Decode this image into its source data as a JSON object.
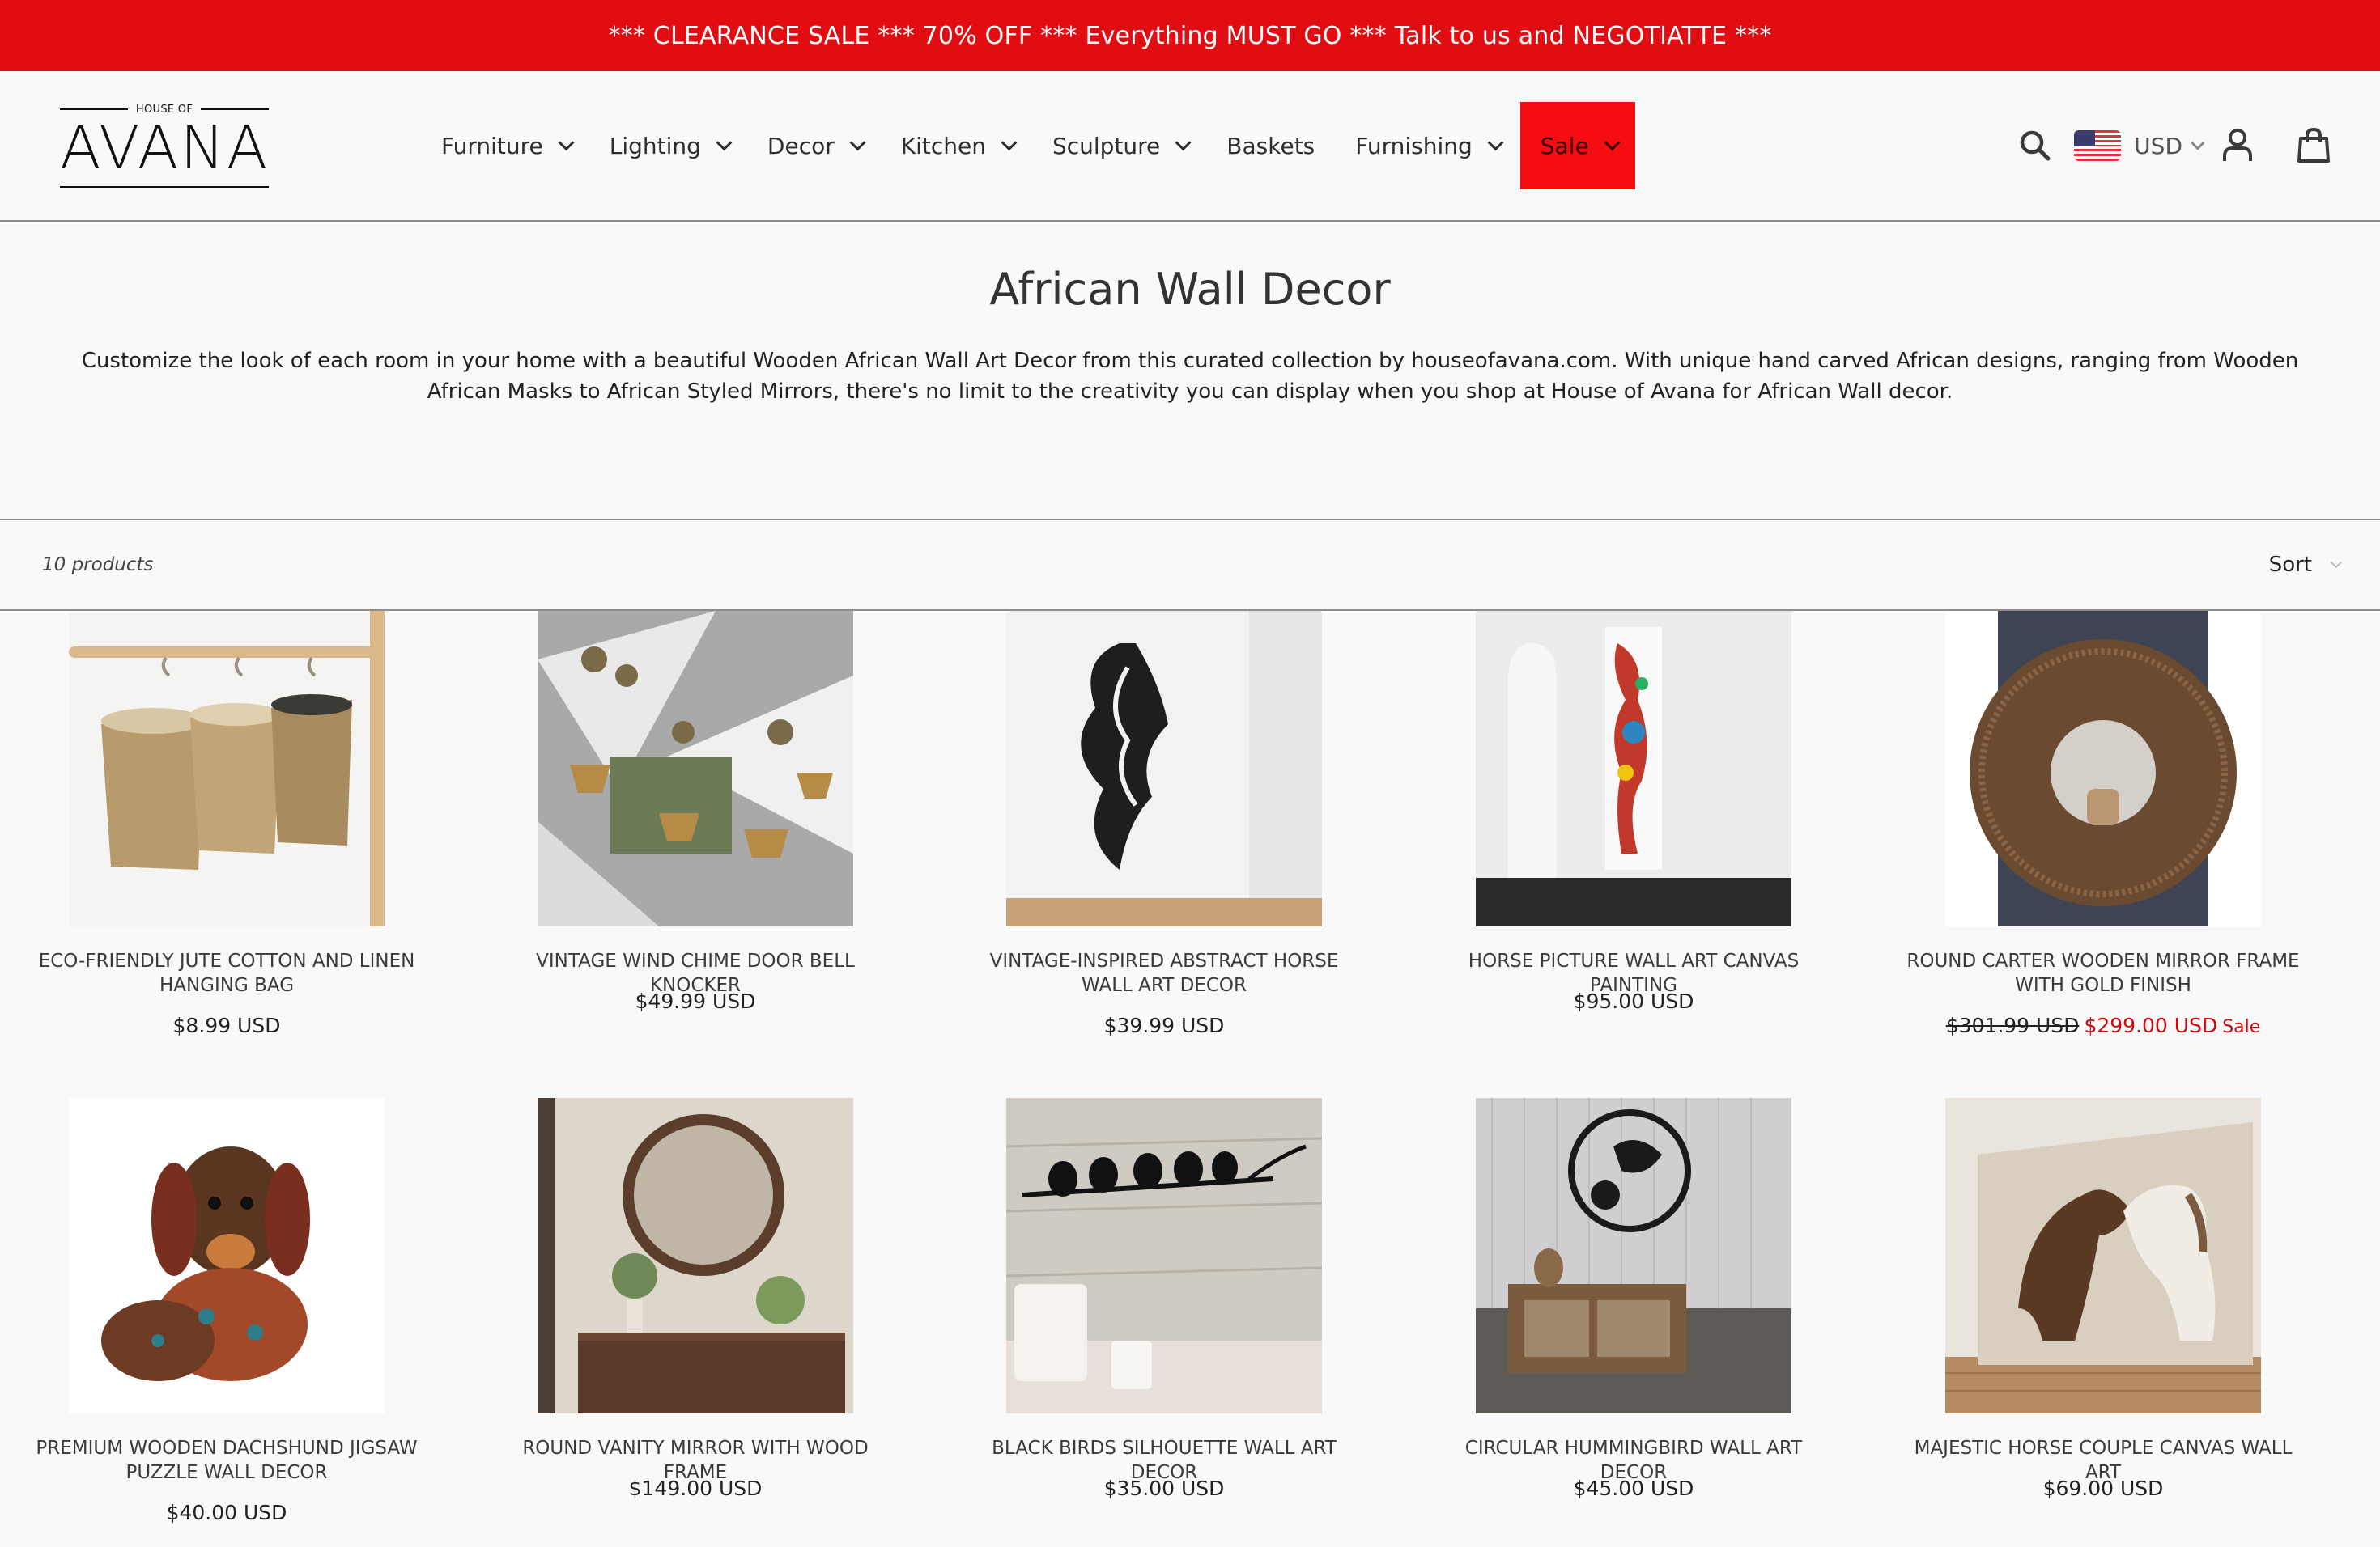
{
  "announcement": "*** CLEARANCE SALE *** 70% OFF *** Everything MUST GO *** Talk to us and NEGOTIATTE ***",
  "logo": {
    "small": "HOUSE OF",
    "big": "AVANA"
  },
  "nav": [
    {
      "label": "Furniture",
      "dropdown": true
    },
    {
      "label": "Lighting",
      "dropdown": true
    },
    {
      "label": "Decor",
      "dropdown": true
    },
    {
      "label": "Kitchen",
      "dropdown": true
    },
    {
      "label": "Sculpture",
      "dropdown": true
    },
    {
      "label": "Baskets",
      "dropdown": false
    },
    {
      "label": "Furnishing",
      "dropdown": true
    },
    {
      "label": "Sale",
      "dropdown": true,
      "highlight": "#f50d12"
    }
  ],
  "header_icons": [
    "search-icon",
    "user-icon",
    "cart-icon"
  ],
  "currency": {
    "code": "USD",
    "flag": "us-flag-icon"
  },
  "collection": {
    "title": "African Wall Decor",
    "description": "Customize the look of each room in your home with a beautiful Wooden African Wall Art Decor from this curated collection by houseofavana.com. With unique hand carved African designs, ranging from Wooden African Masks to African Styled Mirrors, there's no limit to the creativity you can display when you shop at House of Avana for African Wall decor."
  },
  "product_count": "10 products",
  "sort_label": "Sort",
  "colors": {
    "announce_bg": "#e10d12",
    "sale_red": "#d0080c",
    "page_bg": "#f9f9f9"
  },
  "products": [
    {
      "title": "ECO-FRIENDLY JUTE COTTON AND LINEN HANGING BAG",
      "price": "$8.99 USD",
      "image": "jute-baskets-image"
    },
    {
      "title": "VINTAGE WIND CHIME DOOR BELL KNOCKER",
      "price": "$49.99 USD",
      "image": "wind-chime-image"
    },
    {
      "title": "VINTAGE-INSPIRED ABSTRACT HORSE WALL ART DECOR",
      "price": "$39.99 USD",
      "image": "abstract-horse-image"
    },
    {
      "title": "HORSE PICTURE WALL ART CANVAS PAINTING",
      "price": "$95.00 USD",
      "image": "horse-canvas-image"
    },
    {
      "title": "ROUND CARTER WOODEN MIRROR FRAME WITH GOLD FINISH",
      "price_old": "$301.99 USD",
      "price": "$299.00 USD",
      "sale_tag": "Sale",
      "image": "round-mirror-image"
    },
    {
      "title": "PREMIUM WOODEN DACHSHUND JIGSAW PUZZLE WALL DECOR",
      "price": "$40.00 USD",
      "image": "dachshund-puzzle-image"
    },
    {
      "title": "ROUND VANITY MIRROR WITH WOOD FRAME",
      "price": "$149.00 USD",
      "image": "vanity-mirror-image"
    },
    {
      "title": "BLACK BIRDS SILHOUETTE WALL ART DECOR",
      "price": "$35.00 USD",
      "image": "birds-silhouette-image"
    },
    {
      "title": "CIRCULAR HUMMINGBIRD WALL ART DECOR",
      "price": "$45.00 USD",
      "image": "hummingbird-art-image"
    },
    {
      "title": "MAJESTIC HORSE COUPLE CANVAS WALL ART",
      "price": "$69.00 USD",
      "image": "horse-couple-image"
    }
  ]
}
